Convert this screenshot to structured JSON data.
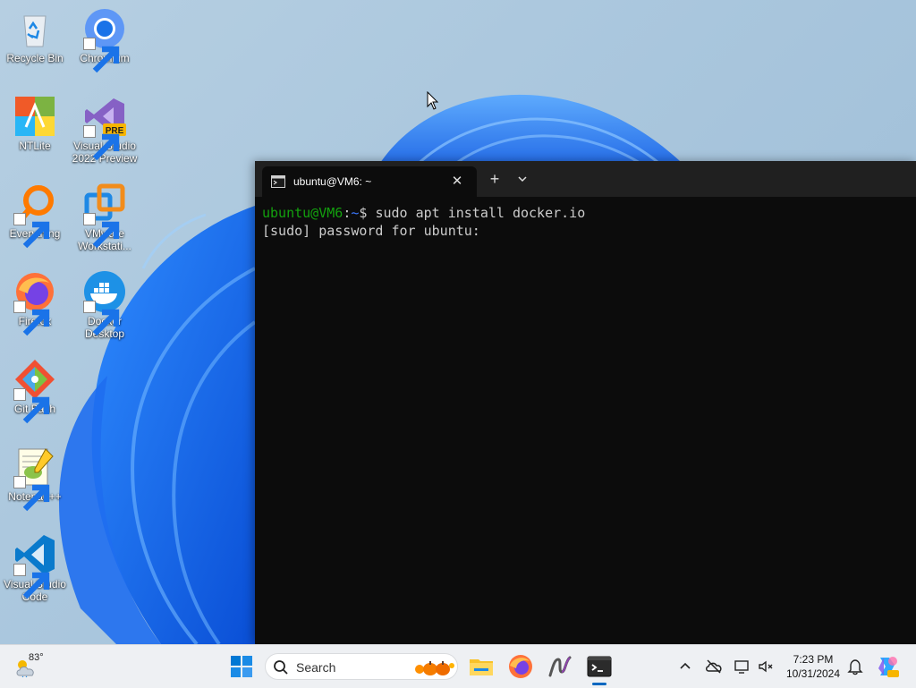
{
  "desktop": {
    "icons": [
      {
        "label": "Recycle Bin",
        "icon": "recycle-bin-icon"
      },
      {
        "label": "Chromium",
        "icon": "chromium-icon"
      },
      {
        "label": "NTLite",
        "icon": "ntlite-icon"
      },
      {
        "label": "Visual Studio 2022 Preview",
        "icon": "visual-studio-icon",
        "badge": "PRE"
      },
      {
        "label": "Everything",
        "icon": "everything-search-icon"
      },
      {
        "label": "VMware Workstati...",
        "icon": "vmware-icon"
      },
      {
        "label": "Firefox",
        "icon": "firefox-icon"
      },
      {
        "label": "Docker Desktop",
        "icon": "docker-icon"
      },
      {
        "label": "Git Bash",
        "icon": "git-bash-icon"
      },
      {
        "label": "Notepad++",
        "icon": "notepad-plus-plus-icon"
      },
      {
        "label": "Visual Studio Code",
        "icon": "vscode-icon"
      }
    ]
  },
  "terminal": {
    "tab_title": "ubuntu@VM6: ~",
    "close_glyph": "✕",
    "new_tab_glyph": "+",
    "lines": [
      {
        "user_host": "ubuntu@VM6",
        "sep": ":",
        "path": "~",
        "prompt": "$ ",
        "command": "sudo apt install docker.io"
      },
      {
        "text": "[sudo] password for ubuntu:"
      }
    ]
  },
  "taskbar": {
    "weather": {
      "temp": "83°"
    },
    "search": {
      "placeholder": "Search"
    },
    "clock": {
      "time": "7:23 PM",
      "date": "10/31/2024"
    },
    "apps": [
      "windows-start-icon",
      "file-explorer-icon",
      "firefox-icon",
      "inkscape-icon",
      "terminal-icon"
    ]
  },
  "colors": {
    "terminal_bg": "#0c0c0c",
    "prompt_green": "#13a10e",
    "prompt_blue": "#3b78ff",
    "taskbar_bg": "#eef0f3",
    "accent": "#0067c0"
  }
}
